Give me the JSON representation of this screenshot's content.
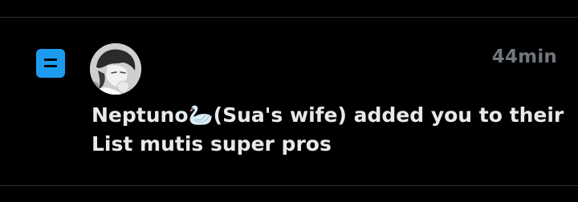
{
  "notification": {
    "type_icon": "list-icon",
    "timestamp": "44min",
    "user_name": "Neptuno",
    "user_emoji": "🦢",
    "user_suffix": "(Sua's wife)",
    "action_text": " added you to their List ",
    "list_name": "mutis super pros"
  },
  "colors": {
    "background": "#000000",
    "accent": "#1d9bf0",
    "text_primary": "#e7e9ea",
    "text_secondary": "#71767b",
    "divider": "#2f3336"
  }
}
